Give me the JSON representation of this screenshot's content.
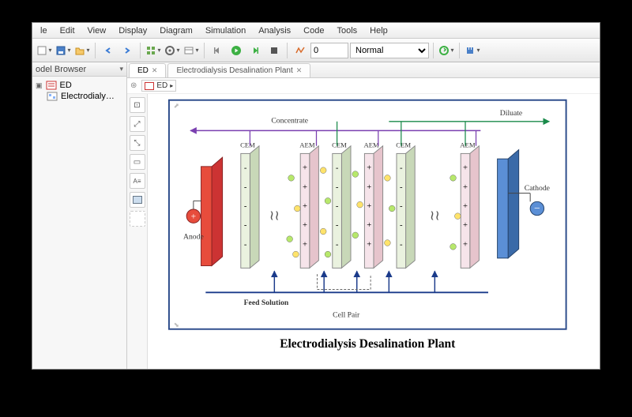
{
  "menu": {
    "items": [
      "le",
      "Edit",
      "View",
      "Display",
      "Diagram",
      "Simulation",
      "Analysis",
      "Code",
      "Tools",
      "Help"
    ]
  },
  "toolbar": {
    "step_value": "0",
    "mode_value": "Normal"
  },
  "sidebar": {
    "title": "odel Browser",
    "root": "ED",
    "child": "Electrodialysis Desa"
  },
  "tabs": {
    "items": [
      {
        "label": "ED",
        "active": true
      },
      {
        "label": "Electrodialysis Desalination Plant",
        "active": false
      }
    ]
  },
  "breadcrumb": {
    "root": "ED"
  },
  "diagram": {
    "title": "Electrodialysis Desalination Plant",
    "top_left_label": "Concentrate",
    "top_right_label": "Diluate",
    "bottom_label": "Feed Solution",
    "cellpair_label": "Cell Pair",
    "anode_label": "Anode",
    "cathode_label": "Cathode",
    "membranes": [
      "CEM",
      "AEM",
      "CEM",
      "AEM",
      "CEM",
      "AEM"
    ]
  }
}
